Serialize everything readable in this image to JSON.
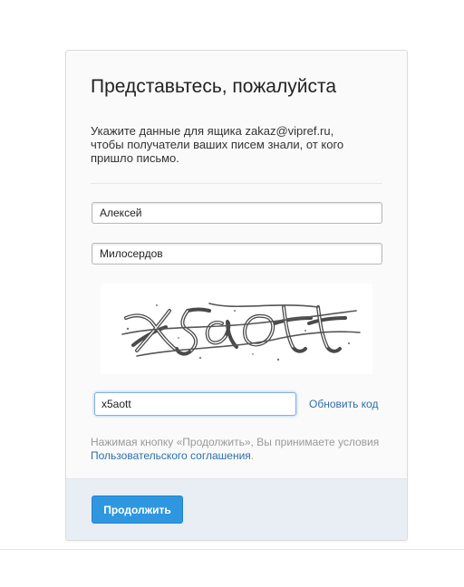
{
  "card": {
    "title": "Представьтесь, пожалуйста",
    "intro": "Укажите данные для ящика zakaz@vipref.ru, чтобы получатели ваших писем знали, от кого пришло письмо."
  },
  "form": {
    "first_name_value": "Алексей",
    "last_name_value": "Милосердов",
    "captcha_text": "x5aott",
    "captcha_input_value": "x5aott",
    "refresh_label": "Обновить код"
  },
  "terms": {
    "text": "Нажимая кнопку «Продолжить», Вы принимаете условия",
    "link_label": "Пользовательского соглашения",
    "suffix": "."
  },
  "footer": {
    "continue_label": "Продолжить"
  },
  "colors": {
    "primary_button": "#2e97e0",
    "link": "#2c6fa8",
    "footer_bg": "#e9eef5"
  }
}
